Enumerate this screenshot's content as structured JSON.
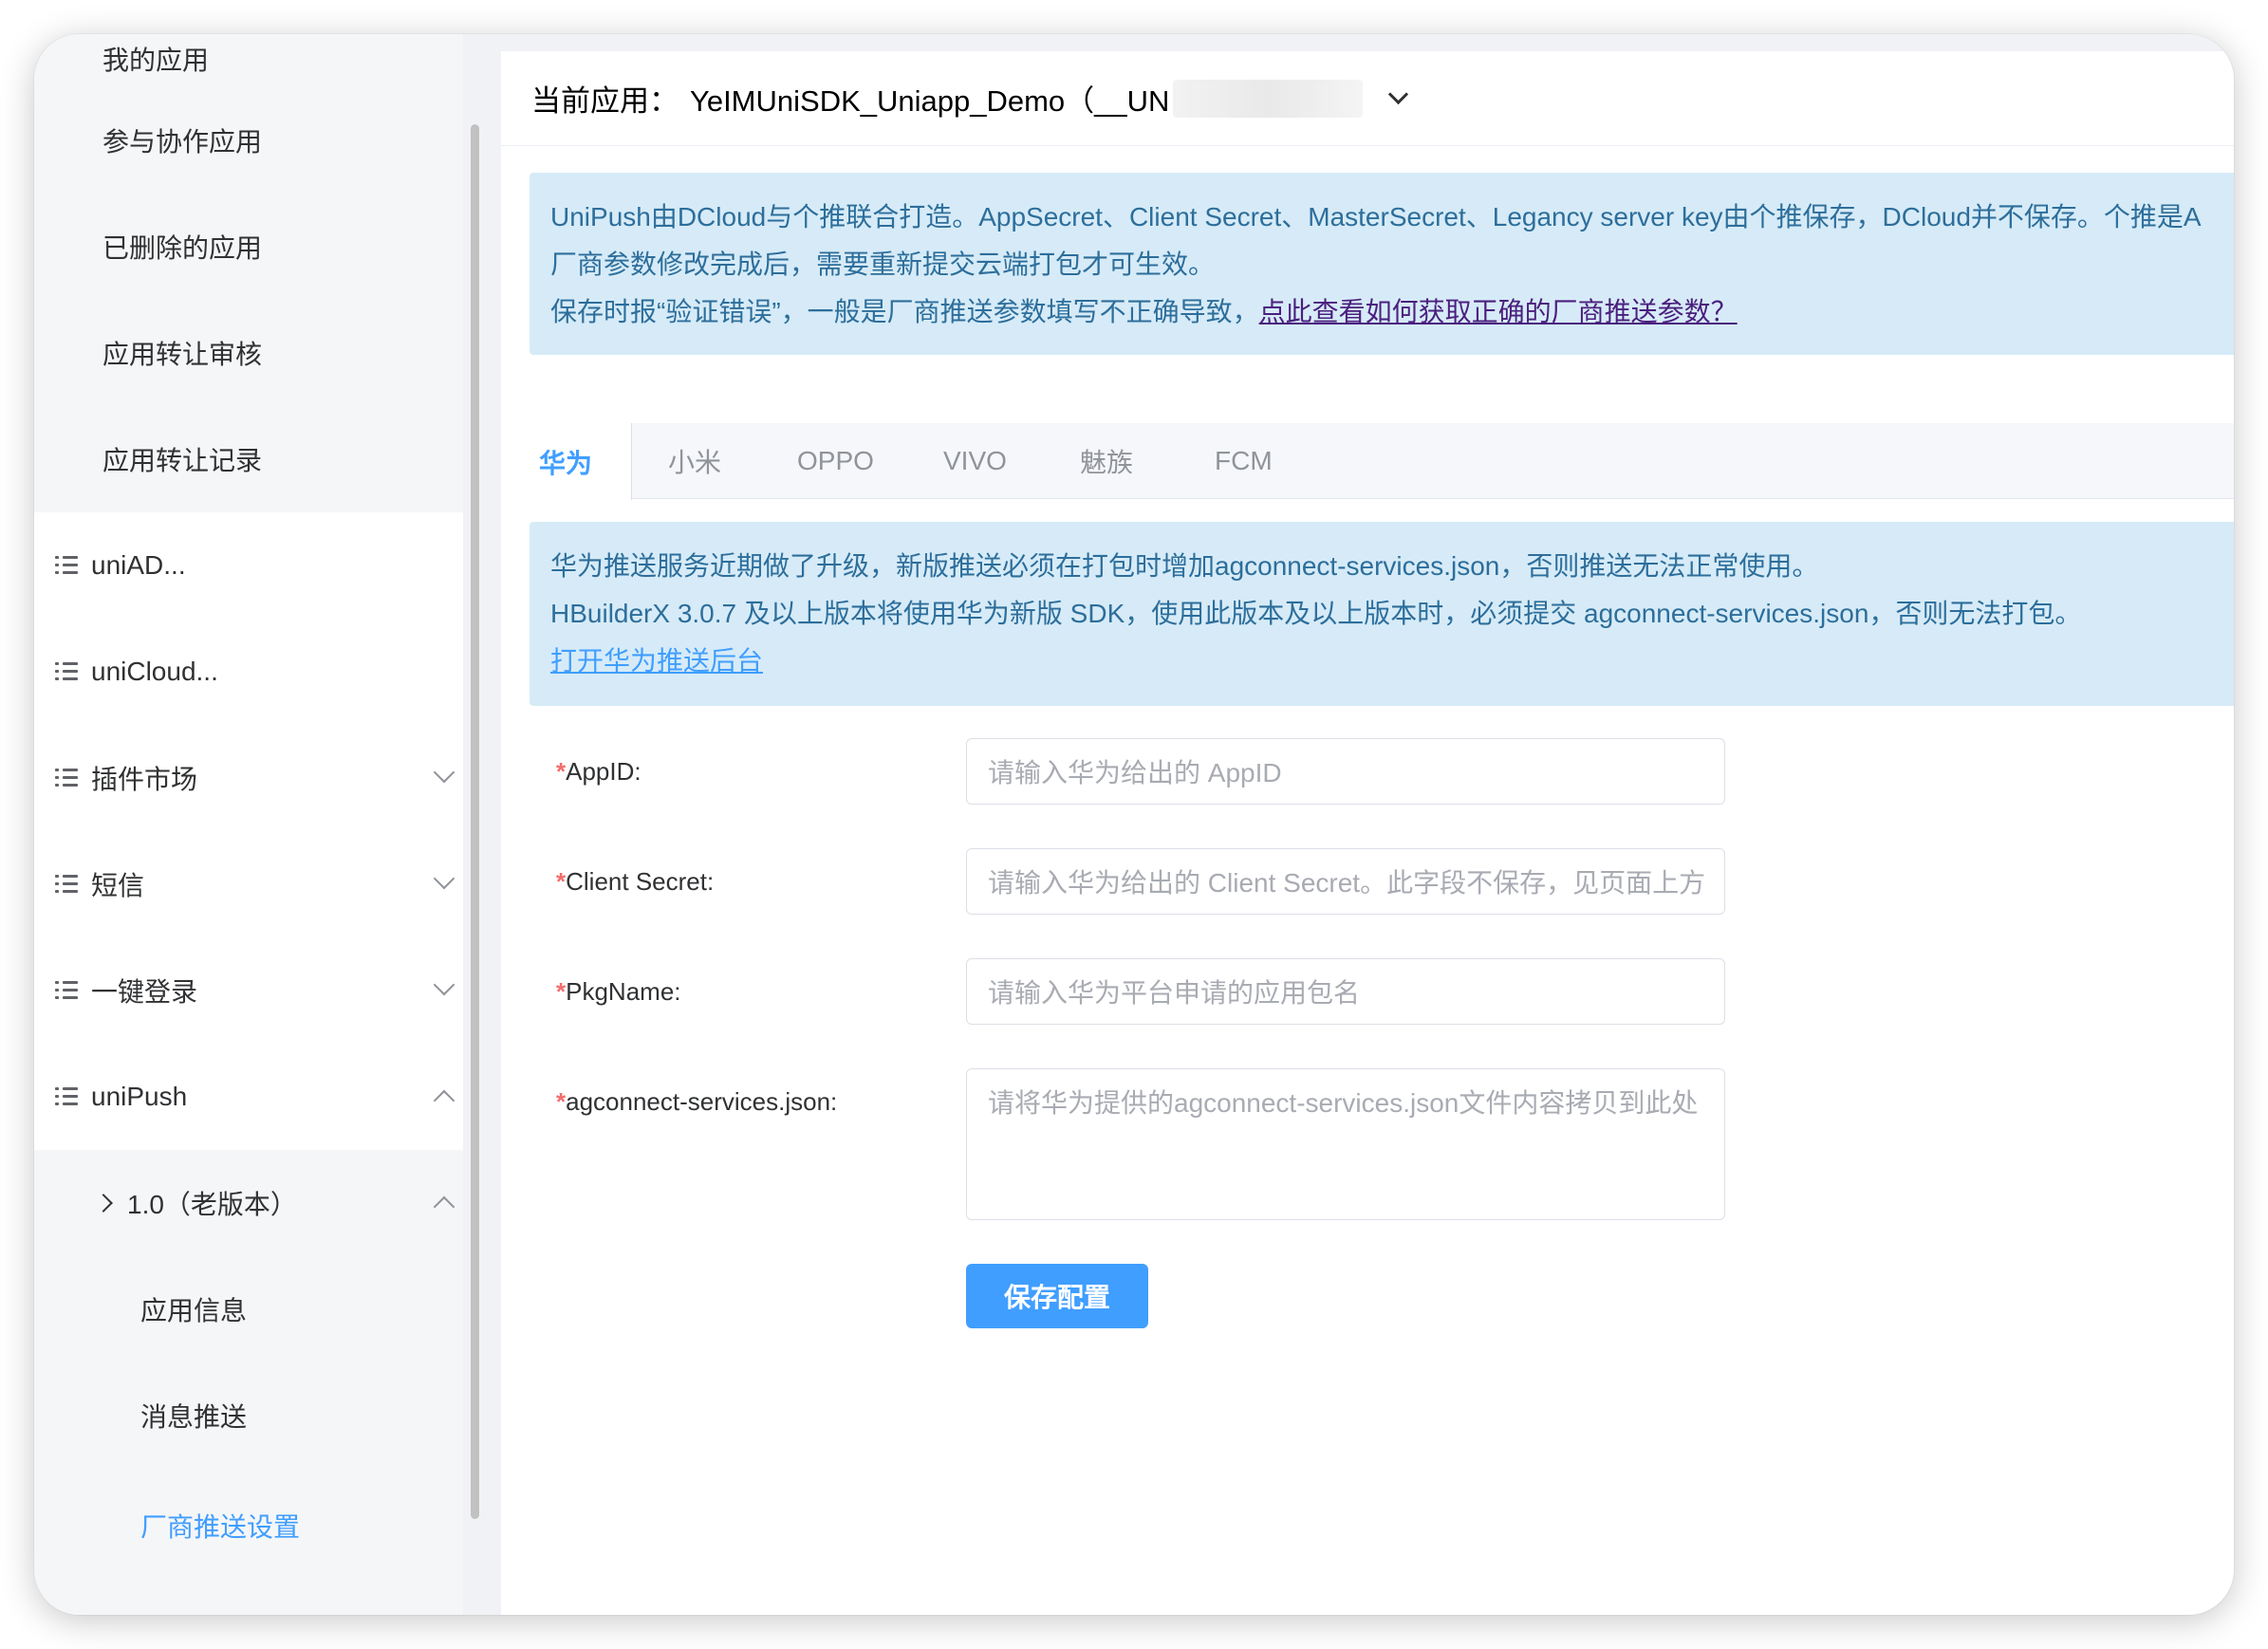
{
  "sidebar": {
    "items": [
      {
        "label": "我的应用"
      },
      {
        "label": "参与协作应用"
      },
      {
        "label": "已删除的应用"
      },
      {
        "label": "应用转让审核"
      },
      {
        "label": "应用转让记录"
      }
    ],
    "groups": [
      {
        "label": "uniAD..."
      },
      {
        "label": "uniCloud..."
      },
      {
        "label": "插件市场"
      },
      {
        "label": "短信"
      },
      {
        "label": "一键登录"
      },
      {
        "label": "uniPush"
      }
    ],
    "unipush": {
      "version_label": "1.0（老版本）",
      "children": [
        {
          "label": "应用信息"
        },
        {
          "label": "消息推送"
        },
        {
          "label": "厂商推送设置"
        }
      ]
    }
  },
  "header": {
    "app_label": "当前应用：",
    "app_name": "YeIMUniSDK_Uniapp_Demo（__UN"
  },
  "notice1": {
    "line1": "UniPush由DCloud与个推联合打造。AppSecret、Client Secret、MasterSecret、Legancy server key由个推保存，DCloud并不保存。个推是A",
    "line2": "厂商参数修改完成后，需要重新提交云端打包才可生效。",
    "line3_prefix": "保存时报“验证错误”，一般是厂商推送参数填写不正确导致，",
    "line3_link": "点此查看如何获取正确的厂商推送参数？"
  },
  "tabs": [
    {
      "label": "华为"
    },
    {
      "label": "小米"
    },
    {
      "label": "OPPO"
    },
    {
      "label": "VIVO"
    },
    {
      "label": "魅族"
    },
    {
      "label": "FCM"
    }
  ],
  "notice2": {
    "line1": "华为推送服务近期做了升级，新版推送必须在打包时增加agconnect-services.json，否则推送无法正常使用。",
    "line2": "HBuilderX 3.0.7 及以上版本将使用华为新版 SDK，使用此版本及以上版本时，必须提交 agconnect-services.json，否则无法打包。",
    "link": "打开华为推送后台"
  },
  "form": {
    "required_mark": "*",
    "appid_label": "AppID:",
    "appid_placeholder": "请输入华为给出的 AppID",
    "secret_label": "Client Secret:",
    "secret_placeholder": "请输入华为给出的 Client Secret。此字段不保存，见页面上方",
    "pkg_label": "PkgName:",
    "pkg_placeholder": "请输入华为平台申请的应用包名",
    "json_label": "agconnect-services.json:",
    "json_placeholder": "请将华为提供的agconnect-services.json文件内容拷贝到此处",
    "save_label": "保存配置"
  }
}
